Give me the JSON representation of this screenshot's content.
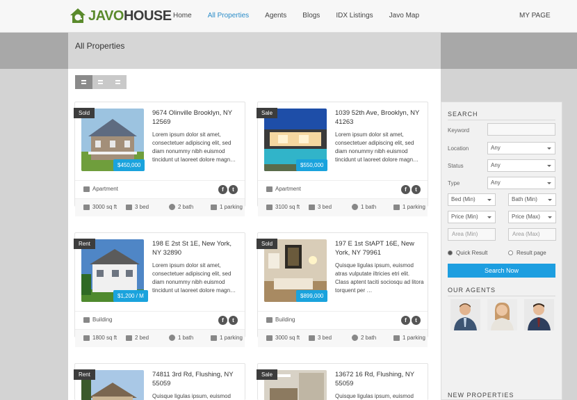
{
  "header": {
    "logo_a": "JAVO",
    "logo_b": "HOUSE",
    "nav": [
      "Home",
      "All Properties",
      "Agents",
      "Blogs",
      "IDX Listings",
      "Javo Map"
    ],
    "my_page": "MY PAGE"
  },
  "page": {
    "title": "All Properties"
  },
  "cards": [
    {
      "tag": "Sold",
      "price": "$450,000",
      "title": "9674 Olinville Brooklyn, NY 12569",
      "desc": "Lorem ipsum dolor sit amet, consectetuer adipiscing elit, sed diam nonummy nibh euismod tincidunt ut laoreet dolore magn…",
      "type": "Apartment",
      "sqft": "3000 sq ft",
      "bed": "3 bed",
      "bath": "2 bath",
      "parking": "1 parking"
    },
    {
      "tag": "Sale",
      "price": "$550,000",
      "title": "1039 52th Ave, Brooklyn, NY 41263",
      "desc": "Lorem ipsum dolor sit amet, consectetuer adipiscing elit, sed diam nonummy nibh euismod tincidunt ut laoreet dolore magn…",
      "type": "Apartment",
      "sqft": "3100 sq ft",
      "bed": "3 bed",
      "bath": "1 bath",
      "parking": "1 parking"
    },
    {
      "tag": "Rent",
      "price": "$1,200 / M",
      "title": "198 E 2st St 1E, New York, NY 32890",
      "desc": "Lorem ipsum dolor sit amet, consectetuer adipiscing elit, sed diam nonummy nibh euismod tincidunt ut laoreet dolore magn…",
      "type": "Building",
      "sqft": "1800 sq ft",
      "bed": "2 bed",
      "bath": "1 bath",
      "parking": "1 parking"
    },
    {
      "tag": "Sold",
      "price": "$899,000",
      "title": "197 E 1st StAPT 16E, New York, NY 79961",
      "desc": "Quisque ligulas ipsum, euismod atras vulputate iltricies etri elit. Class aptent taciti sociosqu ad litora torquent per …",
      "type": "Building",
      "sqft": "3000 sq ft",
      "bed": "3 bed",
      "bath": "2 bath",
      "parking": "1 parking"
    },
    {
      "tag": "Rent",
      "title": "74811 3rd Rd, Flushing, NY 55059",
      "desc": "Quisque ligulas ipsum, euismod"
    },
    {
      "tag": "Sale",
      "title": "13672 16 Rd, Flushing, NY 55059",
      "desc": "Quisque ligulas ipsum, euismod"
    }
  ],
  "sidebar": {
    "search_title": "SEARCH",
    "keyword_label": "Keyword",
    "location_label": "Location",
    "location_value": "Any",
    "status_label": "Status",
    "status_value": "Any",
    "type_label": "Type",
    "type_value": "Any",
    "bed_min": "Bed (Min)",
    "bath_min": "Bath (Min)",
    "price_min": "Price (Min)",
    "price_max": "Price (Max)",
    "area_min": "Area (Min)",
    "area_max": "Area (Max)",
    "quick_result": "Quick Result",
    "result_page": "Result page",
    "search_button": "Search Now",
    "agents_title": "OUR AGENTS",
    "new_props_title": "NEW PROPERTIES"
  },
  "colors": {
    "accent": "#1aa3dd",
    "brand_green": "#5a8a2c",
    "tag_bg": "#3c3c3c"
  }
}
